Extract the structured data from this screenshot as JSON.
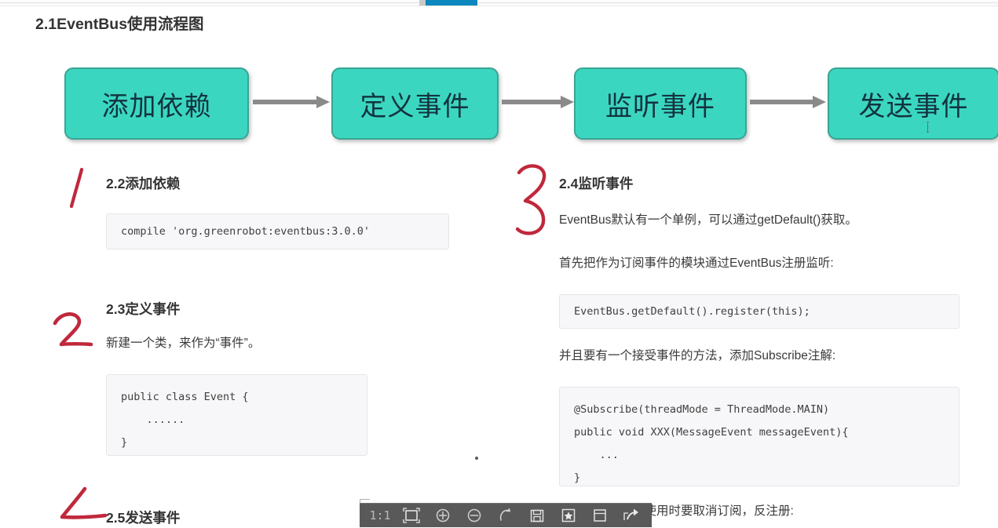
{
  "window": {
    "top_bar_active_tab_color": "#0b88bd"
  },
  "article": {
    "title": "2.1EventBus使用流程图",
    "flowchart": {
      "steps": [
        {
          "label": "添加依赖"
        },
        {
          "label": "定义事件"
        },
        {
          "label": "监听事件"
        },
        {
          "label": "发送事件"
        }
      ],
      "box_fill": "#3bd6c0",
      "box_border": "#3aa594",
      "arrow_color": "#8a8a8a"
    },
    "sections": [
      {
        "id": "2.2",
        "heading": "2.2添加依赖",
        "code": "compile 'org.greenrobot:eventbus:3.0.0'"
      },
      {
        "id": "2.3",
        "heading": "2.3定义事件",
        "paragraph": "新建一个类，来作为“事件”。",
        "code": "public class Event {\n    ......\n}"
      },
      {
        "id": "2.4",
        "heading": "2.4监听事件",
        "paragraph1": "EventBus默认有一个单例，可以通过getDefault()获取。",
        "paragraph2": "首先把作为订阅事件的模块通过EventBus注册监听:",
        "code1": "EventBus.getDefault().register(this);",
        "paragraph3": "并且要有一个接受事件的方法，添加Subscribe注解:",
        "code2": "@Subscribe(threadMode = ThreadMode.MAIN)\npublic void XXX(MessageEvent messageEvent){\n    ...\n}",
        "paragraph4": "在模块销毁或不使用时要取消订阅，反注册:"
      },
      {
        "id": "2.5",
        "heading": "2.5发送事件"
      }
    ],
    "annotations": [
      {
        "mark": "1",
        "color": "#c0283c"
      },
      {
        "mark": "2",
        "color": "#c0283c"
      },
      {
        "mark": "3",
        "color": "#c0283c"
      },
      {
        "mark": "4",
        "color": "#c0283c"
      }
    ]
  },
  "capture_toolbar": {
    "background": "#595959",
    "items": [
      {
        "name": "ratio-label",
        "label": "1:1",
        "icon": "text"
      },
      {
        "name": "fit-screen-button",
        "label": "",
        "icon": "frame-icon"
      },
      {
        "name": "zoom-in-button",
        "label": "",
        "icon": "zoom-in-icon"
      },
      {
        "name": "zoom-out-button",
        "label": "",
        "icon": "zoom-out-icon"
      },
      {
        "name": "rotate-button",
        "label": "",
        "icon": "rotate-icon"
      },
      {
        "name": "save-button",
        "label": "",
        "icon": "save-icon"
      },
      {
        "name": "favorite-button",
        "label": "",
        "icon": "star-icon"
      },
      {
        "name": "copy-button",
        "label": "",
        "icon": "copy-icon"
      },
      {
        "name": "share-button",
        "label": "",
        "icon": "share-icon"
      }
    ]
  }
}
